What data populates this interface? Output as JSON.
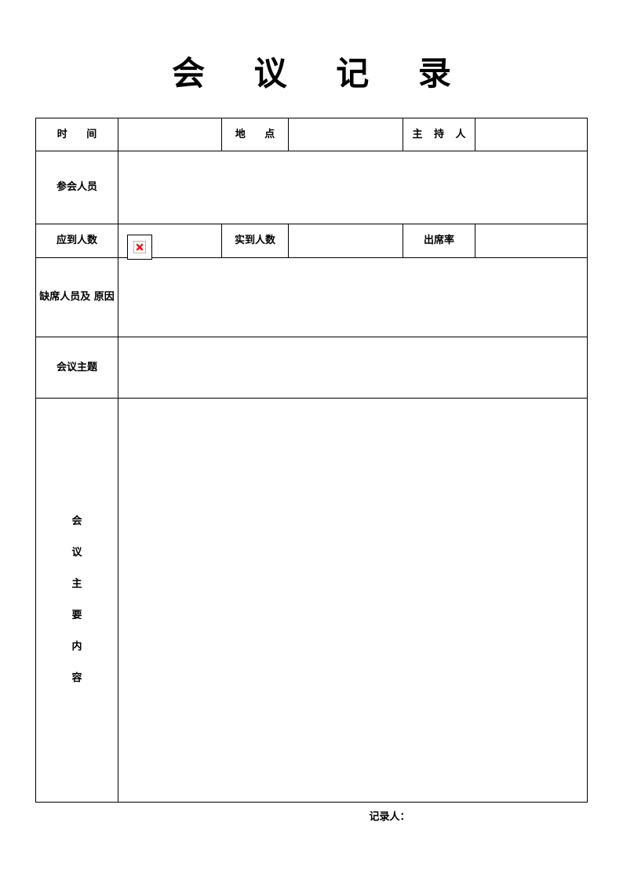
{
  "document": {
    "title": "会 议 记 录",
    "title_plain": "会议记录"
  },
  "table": {
    "rows": {
      "row1": {
        "time_label": "时 间",
        "time_value": "",
        "location_label": "地 点",
        "location_value": "",
        "host_label": "主 持 人",
        "host_value": ""
      },
      "row2": {
        "attendees_label": "参会人员",
        "attendees_value": ""
      },
      "row3": {
        "expected_count_label": "应到人数",
        "expected_count_value": "",
        "actual_count_label": "实到人数",
        "actual_count_value": "",
        "attendance_rate_label": "出席率",
        "attendance_rate_value": ""
      },
      "row4": {
        "absent_label_line1": "缺席人员及",
        "absent_label_line2": "原因",
        "absent_value": ""
      },
      "row5": {
        "topic_label": "会议主题",
        "topic_value": ""
      },
      "row6": {
        "content_label_chars": [
          "会",
          "议",
          "主",
          "要",
          "内",
          "容"
        ],
        "content_value": ""
      }
    }
  },
  "icons": {
    "broken_image": "broken-image-icon",
    "broken_image_mark_color": "#ff0000",
    "broken_image_border_color": "#000000"
  },
  "footer": {
    "recorder_label": "记录人："
  }
}
